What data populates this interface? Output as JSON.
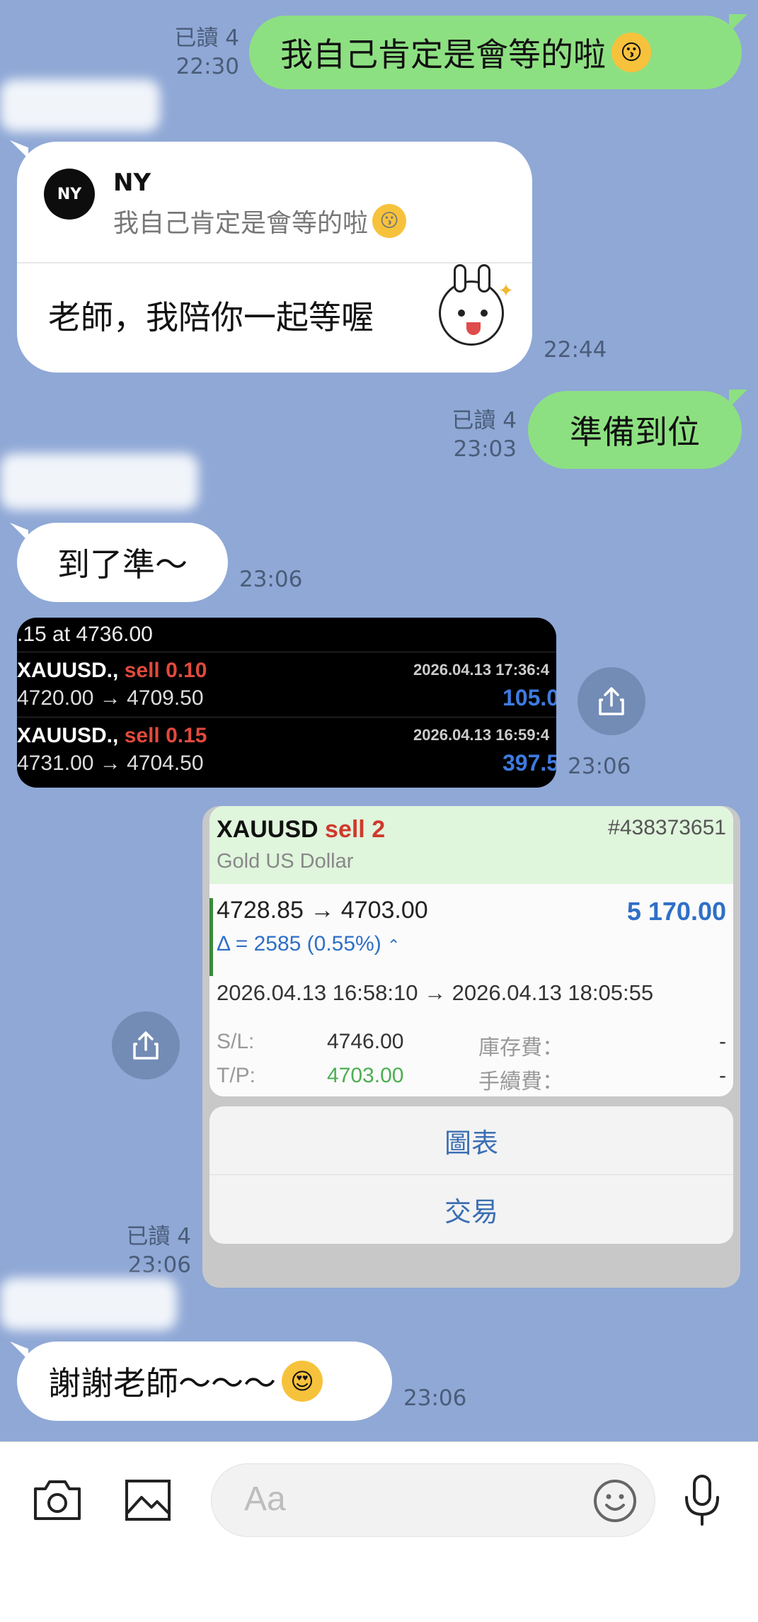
{
  "messages": {
    "m1": {
      "read": "已讀 4",
      "time": "22:30",
      "text": "我自己肯定是會等的啦"
    },
    "m2": {
      "reply_name": "NY",
      "reply_text": "我自己肯定是會等的啦",
      "text": "老師，我陪你一起等喔",
      "time": "22:44"
    },
    "m3": {
      "read": "已讀 4",
      "time": "23:03",
      "text": "準備到位"
    },
    "m4": {
      "text": "到了準～",
      "time": "23:06"
    },
    "m5": {
      "time": "23:06",
      "header_line": ".15 at 4736.00",
      "rows": [
        {
          "symbol": "XAUUSD.,",
          "side": "sell 0.10",
          "date": "2026.04.13 17:36:4",
          "prices": "4720.00 → 4709.50",
          "profit": "105.0"
        },
        {
          "symbol": "XAUUSD.,",
          "side": "sell 0.15",
          "date": "2026.04.13 16:59:4",
          "prices": "4731.00 → 4704.50",
          "profit": "397.5"
        }
      ]
    },
    "m6": {
      "read": "已讀 4",
      "time": "23:06",
      "symbol": "XAUUSD",
      "side": "sell 2",
      "ticket": "#438373651",
      "name": "Gold US Dollar",
      "prices": "4728.85 → 4703.00",
      "profit": "5 170.00",
      "delta": "Δ = 2585 (0.55%)",
      "dates": "2026.04.13 16:58:10 → 2026.04.13 18:05:55",
      "sl_label": "S/L:",
      "sl_value": "4746.00",
      "tp_label": "T/P:",
      "tp_value": "4703.00",
      "swap_label": "庫存費：",
      "swap_value": "-",
      "fee_label": "手續費：",
      "fee_value": "-",
      "menu": [
        "圖表",
        "交易"
      ]
    },
    "m7": {
      "text": "謝謝老師～～～",
      "time": "23:06"
    }
  },
  "input": {
    "placeholder": "Aa"
  },
  "icons": {
    "camera": "camera-icon",
    "image": "image-icon",
    "emoji": "emoji-icon",
    "mic": "mic-icon",
    "share": "share-icon"
  },
  "colors": {
    "chat_bg": "#8fa8d6",
    "out_bubble": "#8de081",
    "in_bubble": "#ffffff",
    "sell_red": "#d0392b",
    "profit_blue": "#2f6fc7",
    "tp_green": "#4caf50"
  }
}
